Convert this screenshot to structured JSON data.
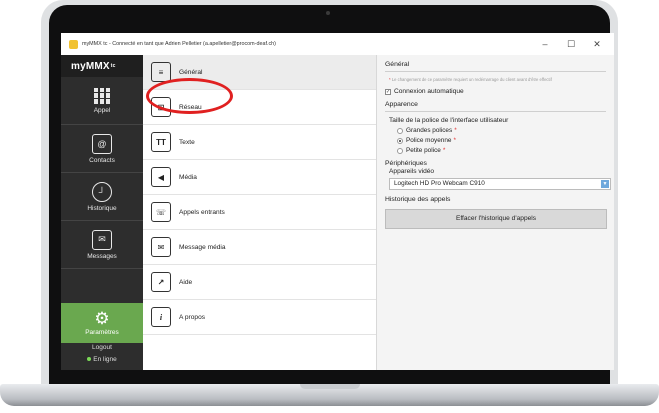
{
  "window": {
    "title": "myMMX tc - Connecté en tant que Adrien Pelletier (a.apelletier@procom-deaf.ch)",
    "minimize_glyph": "–",
    "maximize_glyph": "☐",
    "close_glyph": "✕"
  },
  "sidebar": {
    "logo": "myMMX",
    "logo_sup": "tc",
    "items": [
      {
        "label": "Appel",
        "icon": "dialpad-icon"
      },
      {
        "label": "Contacts",
        "icon": "contact-card-icon"
      },
      {
        "label": "Historique",
        "icon": "clock-icon"
      },
      {
        "label": "Messages",
        "icon": "envelope-icon"
      }
    ],
    "settings_label": "Paramètres",
    "logout_label": "Logout",
    "status_label": "En ligne",
    "status_color": "#7bd957",
    "active_color": "#6aa84f"
  },
  "categories": [
    {
      "label": "Général",
      "icon": "document-icon",
      "glyph": "≡"
    },
    {
      "label": "Réseau",
      "icon": "network-icon",
      "glyph": "⊞"
    },
    {
      "label": "Texte",
      "icon": "text-icon",
      "glyph": "TT"
    },
    {
      "label": "Média",
      "icon": "speaker-icon",
      "glyph": "◀"
    },
    {
      "label": "Appels entrants",
      "icon": "incoming-call-icon",
      "glyph": "☏"
    },
    {
      "label": "Message média",
      "icon": "video-message-icon",
      "glyph": "✉"
    },
    {
      "label": "Aide",
      "icon": "help-arrow-icon",
      "glyph": "↗"
    },
    {
      "label": "A propos",
      "icon": "info-icon",
      "glyph": "i"
    }
  ],
  "panel": {
    "general_heading": "Général",
    "restart_note": "Le changement de ce paramètre requiert un redémarrage du client avant d'être effectif",
    "auto_connect_label": "Connexion automatique",
    "auto_connect_checked": true,
    "appearance_heading": "Apparence",
    "font_size_label": "Taille de la police de l'interface utilisateur",
    "font_options": [
      {
        "label": "Grandes polices",
        "selected": false
      },
      {
        "label": "Police moyenne",
        "selected": true
      },
      {
        "label": "Petite police",
        "selected": false
      }
    ],
    "required_mark": "*",
    "peripherals_heading": "Périphériques",
    "video_devices_label": "Appareils vidéo",
    "video_device_selected": "Logitech HD Pro Webcam C910",
    "history_heading": "Historique des appels",
    "clear_history_button": "Effacer l'historique d'appels"
  }
}
